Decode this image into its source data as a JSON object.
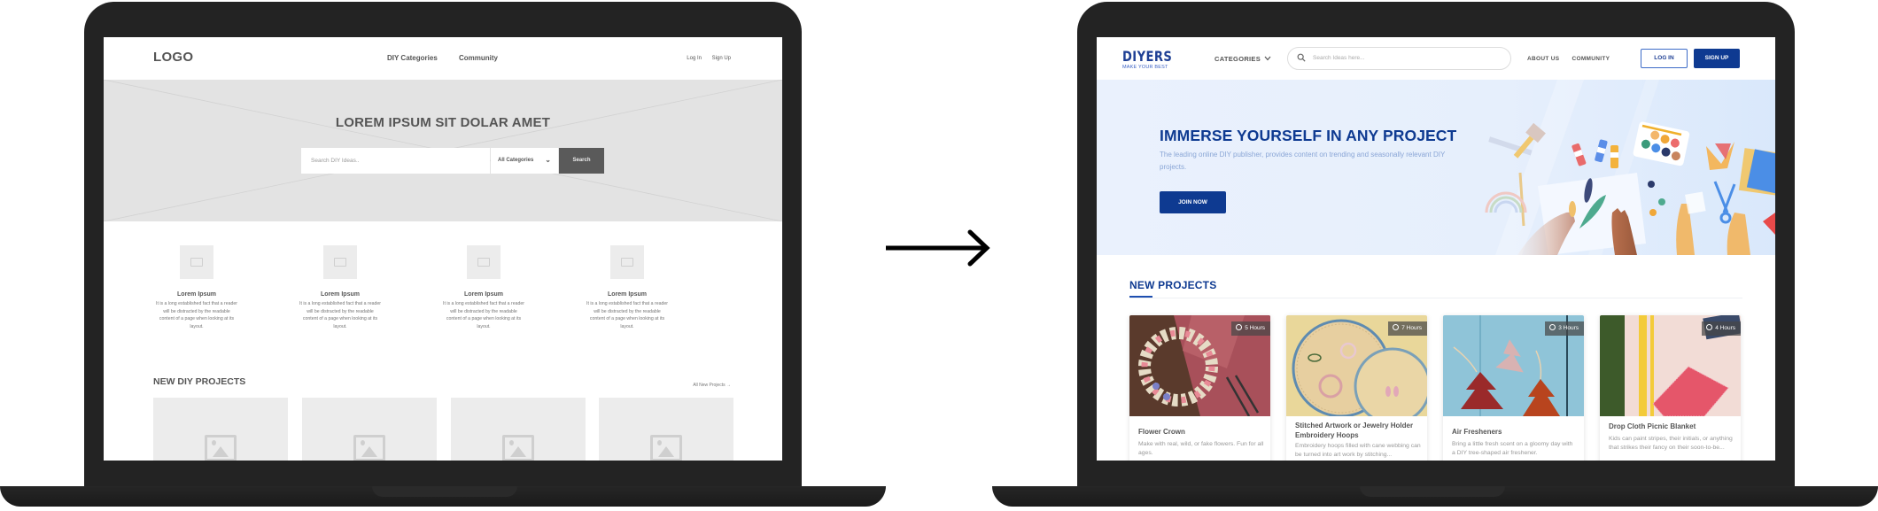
{
  "wireframe": {
    "header": {
      "logo": "LOGO",
      "nav": [
        "DIY Categories",
        "Community"
      ],
      "auth": {
        "login": "Log In",
        "signup": "Sign Up"
      }
    },
    "hero": {
      "title": "LOREM IPSUM SIT DOLAR AMET",
      "search_placeholder": "Search DIY Ideas..",
      "category_select": "All Categories",
      "search_button": "Search"
    },
    "features": [
      {
        "title": "Lorem Ipsum",
        "desc": "It is a long established fact that a reader will be distracted by the readable content of a page when looking at its layout."
      },
      {
        "title": "Lorem Ipsum",
        "desc": "It is a long established fact that a reader will be distracted by the readable content of a page when looking at its layout."
      },
      {
        "title": "Lorem Ipsum",
        "desc": "It is a long established fact that a reader will be distracted by the readable content of a page when looking at its layout."
      },
      {
        "title": "Lorem Ipsum",
        "desc": "It is a long established fact that a reader will be distracted by the readable content of a page when looking at its layout."
      }
    ],
    "projects": {
      "title": "NEW DIY PROJECTS",
      "all_link": "All New Projects",
      "cards": 4
    }
  },
  "arrow": {
    "icon": "right-arrow-icon"
  },
  "final": {
    "colors": {
      "brand": "#0e3a91",
      "brand_light": "#3b62c4",
      "hero_bg": "#e8f0fc"
    },
    "header": {
      "logo": "DIYERS",
      "tagline": "MAKE YOUR BEST",
      "categories": "CATEGORIES",
      "search_placeholder": "Search Ideas here...",
      "nav": [
        "ABOUT US",
        "COMMUNITY"
      ],
      "login": "LOG IN",
      "signup": "SIGN UP"
    },
    "hero": {
      "title": "IMMERSE YOURSELF IN ANY PROJECT",
      "subtitle": "The leading online DIY publisher, provides content on trending and seasonally relevant DIY projects.",
      "cta": "JOIN NOW"
    },
    "projects": {
      "title": "NEW PROJECTS",
      "cards": [
        {
          "title": "Flower Crown",
          "desc": "Make with real, wild, or fake flowers. Fun for all ages.",
          "duration": "5 Hours"
        },
        {
          "title": "Stitched Artwork or Jewelry Holder Embroidery Hoops",
          "desc": "Embroidery hoops filled with cane webbing can be turned into art work by stitching...",
          "duration": "7 Hours"
        },
        {
          "title": "Air Fresheners",
          "desc": "Bring a little fresh scent on a gloomy day with a DIY tree-shaped air freshener.",
          "duration": "3 Hours"
        },
        {
          "title": "Drop Cloth Picnic Blanket",
          "desc": "Kids can paint stripes, their initials, or anything that strikes their fancy on their soon-to-be...",
          "duration": "4 Hours"
        }
      ]
    }
  }
}
